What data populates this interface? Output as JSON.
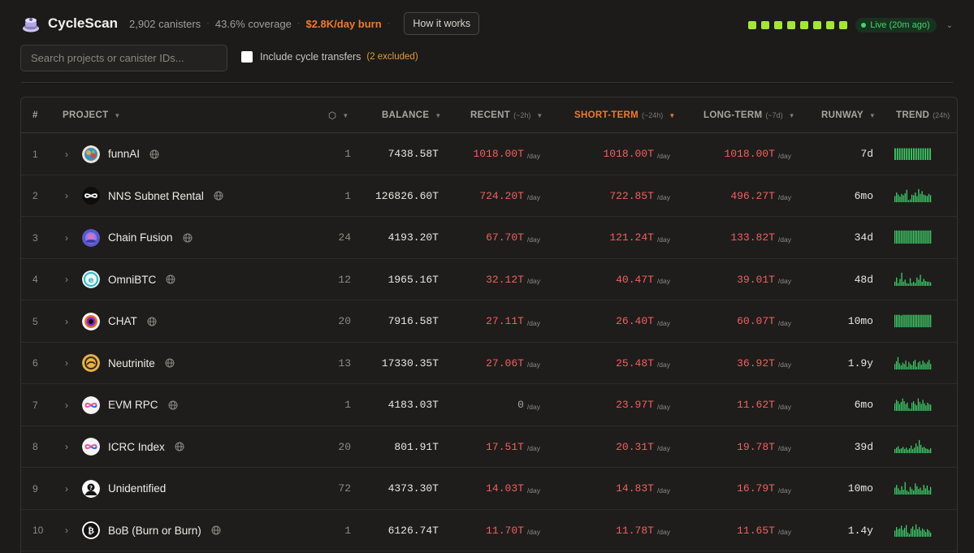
{
  "app": {
    "title": "CycleScan",
    "canisters": "2,902 canisters",
    "coverage": "43.6% coverage",
    "burn": "$2.8K/day burn",
    "how_btn": "How it works",
    "live": "Live (20m ago)",
    "status_count": 8
  },
  "search": {
    "placeholder": "Search projects or canister IDs...",
    "include_label": "Include cycle transfers",
    "excluded": "(2 excluded)"
  },
  "columns": {
    "num": "#",
    "project": "PROJECT",
    "balance": "BALANCE",
    "recent": "RECENT",
    "recent_sub": "(~2h)",
    "short": "SHORT-TERM",
    "short_sub": "(~24h)",
    "long": "LONG-TERM",
    "long_sub": "(~7d)",
    "runway": "RUNWAY",
    "trend": "TREND",
    "trend_sub": "(24h)"
  },
  "colors": {
    "accent": "#f07a2c",
    "burn_red": "#f06060",
    "trend_green": "#3fcf6a",
    "live_green": "#47d36d",
    "status_lime": "#a4e53a"
  },
  "rows": [
    {
      "n": "1",
      "name": "funnAI",
      "icon": "funnai-logo",
      "count": "1",
      "balance": "7438.58T",
      "recent": "1018.00T",
      "short": "1018.00T",
      "long": "1018.00T",
      "runway": "7d",
      "web": true,
      "trend": [
        0.85,
        0.85,
        0.85,
        0.85,
        0.85,
        0.85,
        0.85,
        0.85,
        0.85,
        0.85,
        0.85,
        0.85,
        0.85,
        0.85,
        0.85,
        0.85
      ]
    },
    {
      "n": "2",
      "name": "NNS Subnet Rental",
      "icon": "infinity-logo",
      "count": "1",
      "balance": "126826.60T",
      "recent": "724.20T",
      "short": "722.85T",
      "long": "496.27T",
      "runway": "6mo",
      "web": true,
      "trend": [
        0.45,
        0.7,
        0.55,
        0.4,
        0.6,
        0.5,
        0.65,
        0.9,
        0.15,
        0.2,
        0.55,
        0.5,
        0.7,
        0.45,
        0.95,
        0.6,
        0.8,
        0.55,
        0.5,
        0.45,
        0.6,
        0.5
      ]
    },
    {
      "n": "3",
      "name": "Chain Fusion",
      "icon": "chainfusion-logo",
      "count": "24",
      "balance": "4193.20T",
      "recent": "67.70T",
      "short": "121.24T",
      "long": "133.82T",
      "runway": "34d",
      "web": true,
      "trend": [
        0.95,
        0.95,
        0.95,
        0.95,
        0.95,
        0.95,
        0.95,
        0.95,
        0.95,
        0.95,
        0.95,
        0.95,
        0.95,
        0.95,
        0.95,
        0.95,
        0.95,
        0.95,
        0.95,
        0.95,
        0.95,
        0.95,
        0.95,
        0.95
      ]
    },
    {
      "n": "4",
      "name": "OmniBTC",
      "icon": "omnibtc-logo",
      "count": "12",
      "balance": "1965.16T",
      "recent": "32.12T",
      "short": "40.47T",
      "long": "39.01T",
      "runway": "48d",
      "web": true,
      "trend": [
        0.3,
        0.6,
        0.2,
        0.5,
        0.95,
        0.3,
        0.45,
        0.2,
        0.15,
        0.55,
        0.2,
        0.3,
        0.2,
        0.6,
        0.45,
        0.8,
        0.3,
        0.5,
        0.35,
        0.3,
        0.3,
        0.25
      ]
    },
    {
      "n": "5",
      "name": "CHAT",
      "icon": "chat-logo",
      "count": "20",
      "balance": "7916.58T",
      "recent": "27.11T",
      "short": "26.40T",
      "long": "60.07T",
      "runway": "10mo",
      "web": true,
      "trend": [
        0.9,
        0.9,
        0.9,
        0.9,
        0.85,
        0.9,
        0.9,
        0.9,
        0.9,
        0.9,
        0.9,
        0.9,
        0.9,
        0.9,
        0.9,
        0.9,
        0.9,
        0.9,
        0.9,
        0.9,
        0.9,
        0.9,
        0.9,
        0.9
      ]
    },
    {
      "n": "6",
      "name": "Neutrinite",
      "icon": "neutrinite-logo",
      "count": "13",
      "balance": "17330.35T",
      "recent": "27.06T",
      "short": "25.48T",
      "long": "36.92T",
      "runway": "1.9y",
      "web": true,
      "trend": [
        0.4,
        0.6,
        0.9,
        0.45,
        0.3,
        0.5,
        0.4,
        0.65,
        0.2,
        0.55,
        0.4,
        0.3,
        0.6,
        0.7,
        0.2,
        0.5,
        0.6,
        0.35,
        0.65,
        0.5,
        0.4,
        0.55,
        0.7,
        0.4
      ]
    },
    {
      "n": "7",
      "name": "EVM RPC",
      "icon": "evmrpc-logo",
      "count": "1",
      "balance": "4183.03T",
      "recent": "0",
      "short": "23.97T",
      "long": "11.62T",
      "runway": "6mo",
      "web": true,
      "trend": [
        0.55,
        0.8,
        0.7,
        0.5,
        0.65,
        0.9,
        0.7,
        0.5,
        0.6,
        0.2,
        0.15,
        0.6,
        0.7,
        0.5,
        0.4,
        0.9,
        0.65,
        0.5,
        0.8,
        0.55,
        0.4,
        0.6,
        0.5,
        0.45
      ]
    },
    {
      "n": "8",
      "name": "ICRC Index",
      "icon": "icrcindex-logo",
      "count": "20",
      "balance": "801.91T",
      "recent": "17.51T",
      "short": "20.31T",
      "long": "19.78T",
      "runway": "39d",
      "web": true,
      "trend": [
        0.3,
        0.4,
        0.5,
        0.3,
        0.35,
        0.45,
        0.3,
        0.4,
        0.25,
        0.35,
        0.55,
        0.3,
        0.4,
        0.7,
        0.5,
        0.95,
        0.6,
        0.4,
        0.45,
        0.35,
        0.3,
        0.25,
        0.35
      ]
    },
    {
      "n": "9",
      "name": "Unidentified",
      "icon": "unidentified-logo",
      "count": "72",
      "balance": "4373.30T",
      "recent": "14.03T",
      "short": "14.83T",
      "long": "16.79T",
      "runway": "10mo",
      "web": false,
      "trend": [
        0.5,
        0.7,
        0.45,
        0.3,
        0.6,
        0.35,
        0.9,
        0.3,
        0.2,
        0.55,
        0.4,
        0.3,
        0.8,
        0.6,
        0.4,
        0.5,
        0.3,
        0.7,
        0.45,
        0.65,
        0.3,
        0.55
      ]
    },
    {
      "n": "10",
      "name": "BoB (Burn or Burn)",
      "icon": "bob-logo",
      "count": "1",
      "balance": "6126.74T",
      "recent": "11.70T",
      "short": "11.78T",
      "long": "11.65T",
      "runway": "1.4y",
      "web": true,
      "trend": [
        0.45,
        0.7,
        0.55,
        0.6,
        0.8,
        0.5,
        0.65,
        0.85,
        0.3,
        0.2,
        0.6,
        0.75,
        0.5,
        0.9,
        0.55,
        0.7,
        0.45,
        0.6,
        0.5,
        0.35,
        0.55,
        0.45,
        0.3
      ]
    }
  ],
  "per_day": "/day"
}
